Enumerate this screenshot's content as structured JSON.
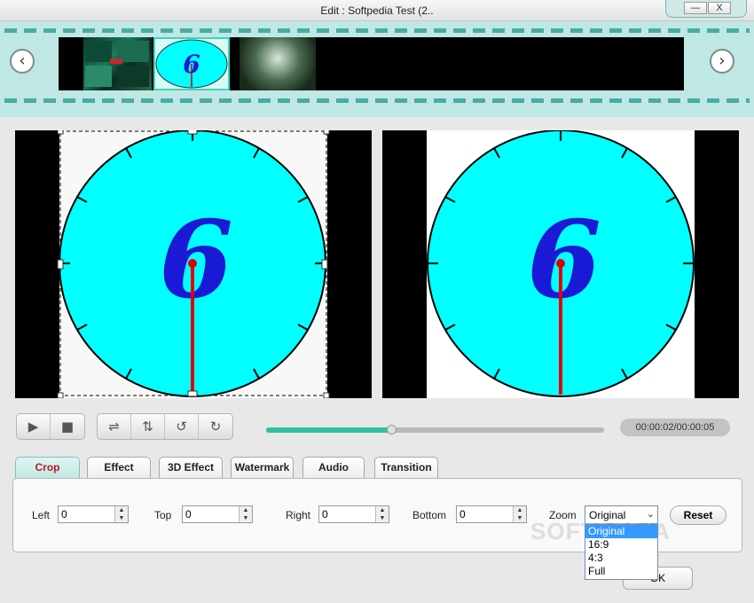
{
  "window": {
    "title": "Edit : Softpedia Test (2..",
    "minimize": "—",
    "close": "X"
  },
  "filmstrip": {
    "prev_icon": "‹",
    "next_icon": "›"
  },
  "preview": {
    "clock_digit": "6"
  },
  "controls": {
    "time": "00:00:02/00:00:05",
    "seek_progress": 0.37
  },
  "tabs": [
    {
      "label": "Crop",
      "active": true
    },
    {
      "label": "Effect",
      "active": false
    },
    {
      "label": "3D Effect",
      "active": false
    },
    {
      "label": "Watermark",
      "active": false
    },
    {
      "label": "Audio",
      "active": false
    },
    {
      "label": "Transition",
      "active": false
    }
  ],
  "crop": {
    "left_label": "Left",
    "left_value": "0",
    "top_label": "Top",
    "top_value": "0",
    "right_label": "Right",
    "right_value": "0",
    "bottom_label": "Bottom",
    "bottom_value": "0",
    "zoom_label": "Zoom",
    "zoom_value": "Original",
    "zoom_options": [
      "Original",
      "16:9",
      "4:3",
      "Full"
    ],
    "reset_label": "Reset"
  },
  "footer": {
    "ok_label": "OK"
  },
  "watermark_text": "SOFTPEDIA",
  "colors": {
    "accent": "#2fc1a4",
    "clock_face": "#00ffff",
    "active_tab_text": "#b41a22"
  }
}
